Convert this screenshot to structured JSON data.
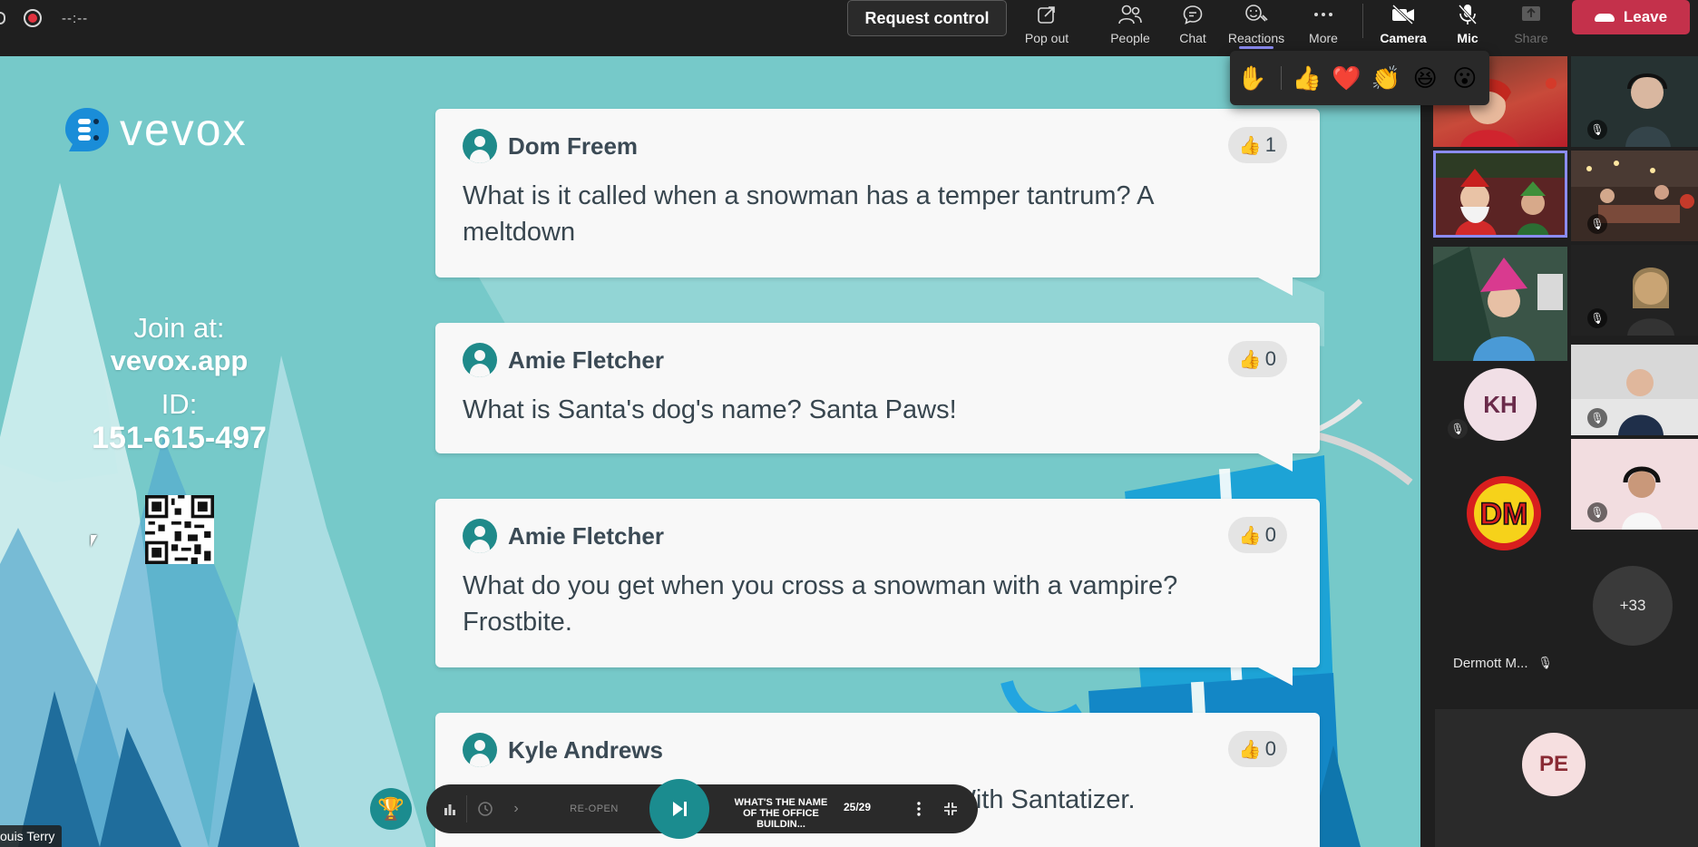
{
  "topbar": {
    "timer": "--:--",
    "request_control": "Request control",
    "buttons": {
      "popout": "Pop out",
      "people": "People",
      "chat": "Chat",
      "reactions": "Reactions",
      "more": "More",
      "camera": "Camera",
      "mic": "Mic",
      "share": "Share"
    },
    "leave": "Leave",
    "accent": "#8b8cf3",
    "leave_color": "#c4314b"
  },
  "reactions_menu": {
    "items": [
      "✋",
      "👍",
      "❤️",
      "👏",
      "😆",
      "😮"
    ]
  },
  "stage": {
    "brand": "vevox",
    "join_label": "Join at:",
    "join_url": "vevox.app",
    "id_label": "ID:",
    "id_value": "151-615-497",
    "presenter_name_tag": "ouis Terry",
    "background_color": "#76c9c9",
    "accent": "#1b8c8f"
  },
  "questions": [
    {
      "author": "Dom Freem",
      "likes": "1",
      "text": "What is it called when a snowman has a temper tantrum? A meltdown"
    },
    {
      "author": "Amie Fletcher",
      "likes": "0",
      "text": "What is Santa's dog's name? Santa Paws!"
    },
    {
      "author": "Amie Fletcher",
      "likes": "0",
      "text": "What do you get when you cross a snowman with a vampire? Frostbite."
    },
    {
      "author": "Kyle Andrews",
      "likes": "0",
      "text": "How do you keep clean over the holiday? With Santatizer."
    }
  ],
  "controls": {
    "reopen": "RE-OPEN",
    "question_title": "WHAT'S THE NAME OF THE OFFICE BUILDIN...",
    "question_count": "25/29"
  },
  "participants": {
    "kh_initials": "KH",
    "pe_initials": "PE",
    "overflow": "+33",
    "dm_name": "Dermott M...",
    "dm_logo_text": "DM"
  }
}
